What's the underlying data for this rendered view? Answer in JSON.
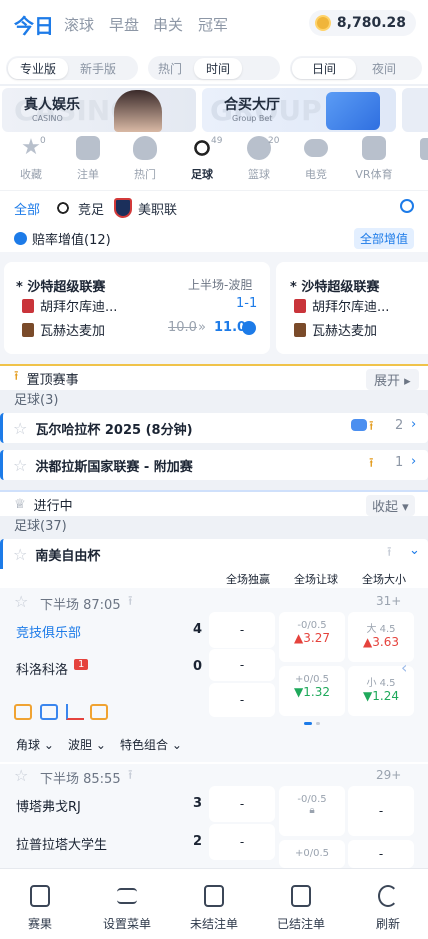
{
  "topnav": {
    "tabs": [
      "今日",
      "滚球",
      "早盘",
      "串关",
      "冠军"
    ],
    "balance": "8,780.28"
  },
  "filters": {
    "version": [
      "专业版",
      "新手版"
    ],
    "sort": [
      "热门",
      "时间"
    ],
    "theme": [
      "日间",
      "夜间"
    ]
  },
  "banners": [
    {
      "title": "真人娱乐",
      "sub": "CASINO",
      "bg": "CASINO"
    },
    {
      "title": "合买大厅",
      "sub": "Group Bet",
      "bg": "GROUP B"
    }
  ],
  "categories": [
    {
      "label": "收藏",
      "count": "0"
    },
    {
      "label": "注单",
      "count": ""
    },
    {
      "label": "热门",
      "count": ""
    },
    {
      "label": "足球",
      "count": "49"
    },
    {
      "label": "篮球",
      "count": "20"
    },
    {
      "label": "电竞",
      "count": ""
    },
    {
      "label": "VR体育",
      "count": ""
    }
  ],
  "subfilter": {
    "all": "全部",
    "item1": "竞足",
    "item2": "美职联"
  },
  "boost": {
    "title": "赔率增值(12)",
    "all_btn": "全部增值",
    "card1": {
      "league": "* 沙特超级联赛",
      "period": "上半场-波胆",
      "home": "胡拜尔库迪...",
      "score": "1-1",
      "away": "瓦赫达麦加",
      "old": "10.0",
      "new": "11.0"
    },
    "card2": {
      "league": "* 沙特超级联赛",
      "home": "胡拜尔库迪...",
      "away": "瓦赫达麦加"
    }
  },
  "pinned": {
    "title": "置顶赛事",
    "expand": "展开",
    "sub": "足球(3)",
    "leagues": [
      {
        "name": "瓦尔哈拉杯 2025 (8分钟)",
        "count": "2"
      },
      {
        "name": "洪都拉斯国家联赛 - 附加赛",
        "count": "1"
      }
    ]
  },
  "live": {
    "title": "进行中",
    "collapse": "收起",
    "sub": "足球(37)",
    "league": "南美自由杯",
    "markets": [
      "全场独赢",
      "全场让球",
      "全场大小"
    ],
    "match1": {
      "time": "下半场 87:05",
      "more": "31+",
      "home": "竞技俱乐部",
      "home_score": "4",
      "away": "科洛科洛",
      "away_score": "0",
      "red_card": "1",
      "dash": "-",
      "hc1_line": "-0/0.5",
      "hc1_odd": "3.27",
      "ou1_line": "大 4.5",
      "ou1_odd": "3.63",
      "hc2_line": "+0/0.5",
      "hc2_odd": "1.32",
      "ou2_line": "小 4.5",
      "ou2_odd": "1.24",
      "filters": [
        "角球",
        "波胆",
        "特色组合"
      ]
    },
    "match2": {
      "time": "下半场 85:55",
      "more": "29+",
      "home": "博塔弗戈RJ",
      "home_score": "3",
      "away": "拉普拉塔大学生",
      "away_score": "2",
      "hc1_line": "-0/0.5",
      "hc2_line": "+0/0.5",
      "dash": "-"
    }
  },
  "bottomnav": [
    "赛果",
    "设置菜单",
    "未结注单",
    "已结注单",
    "刷新"
  ]
}
